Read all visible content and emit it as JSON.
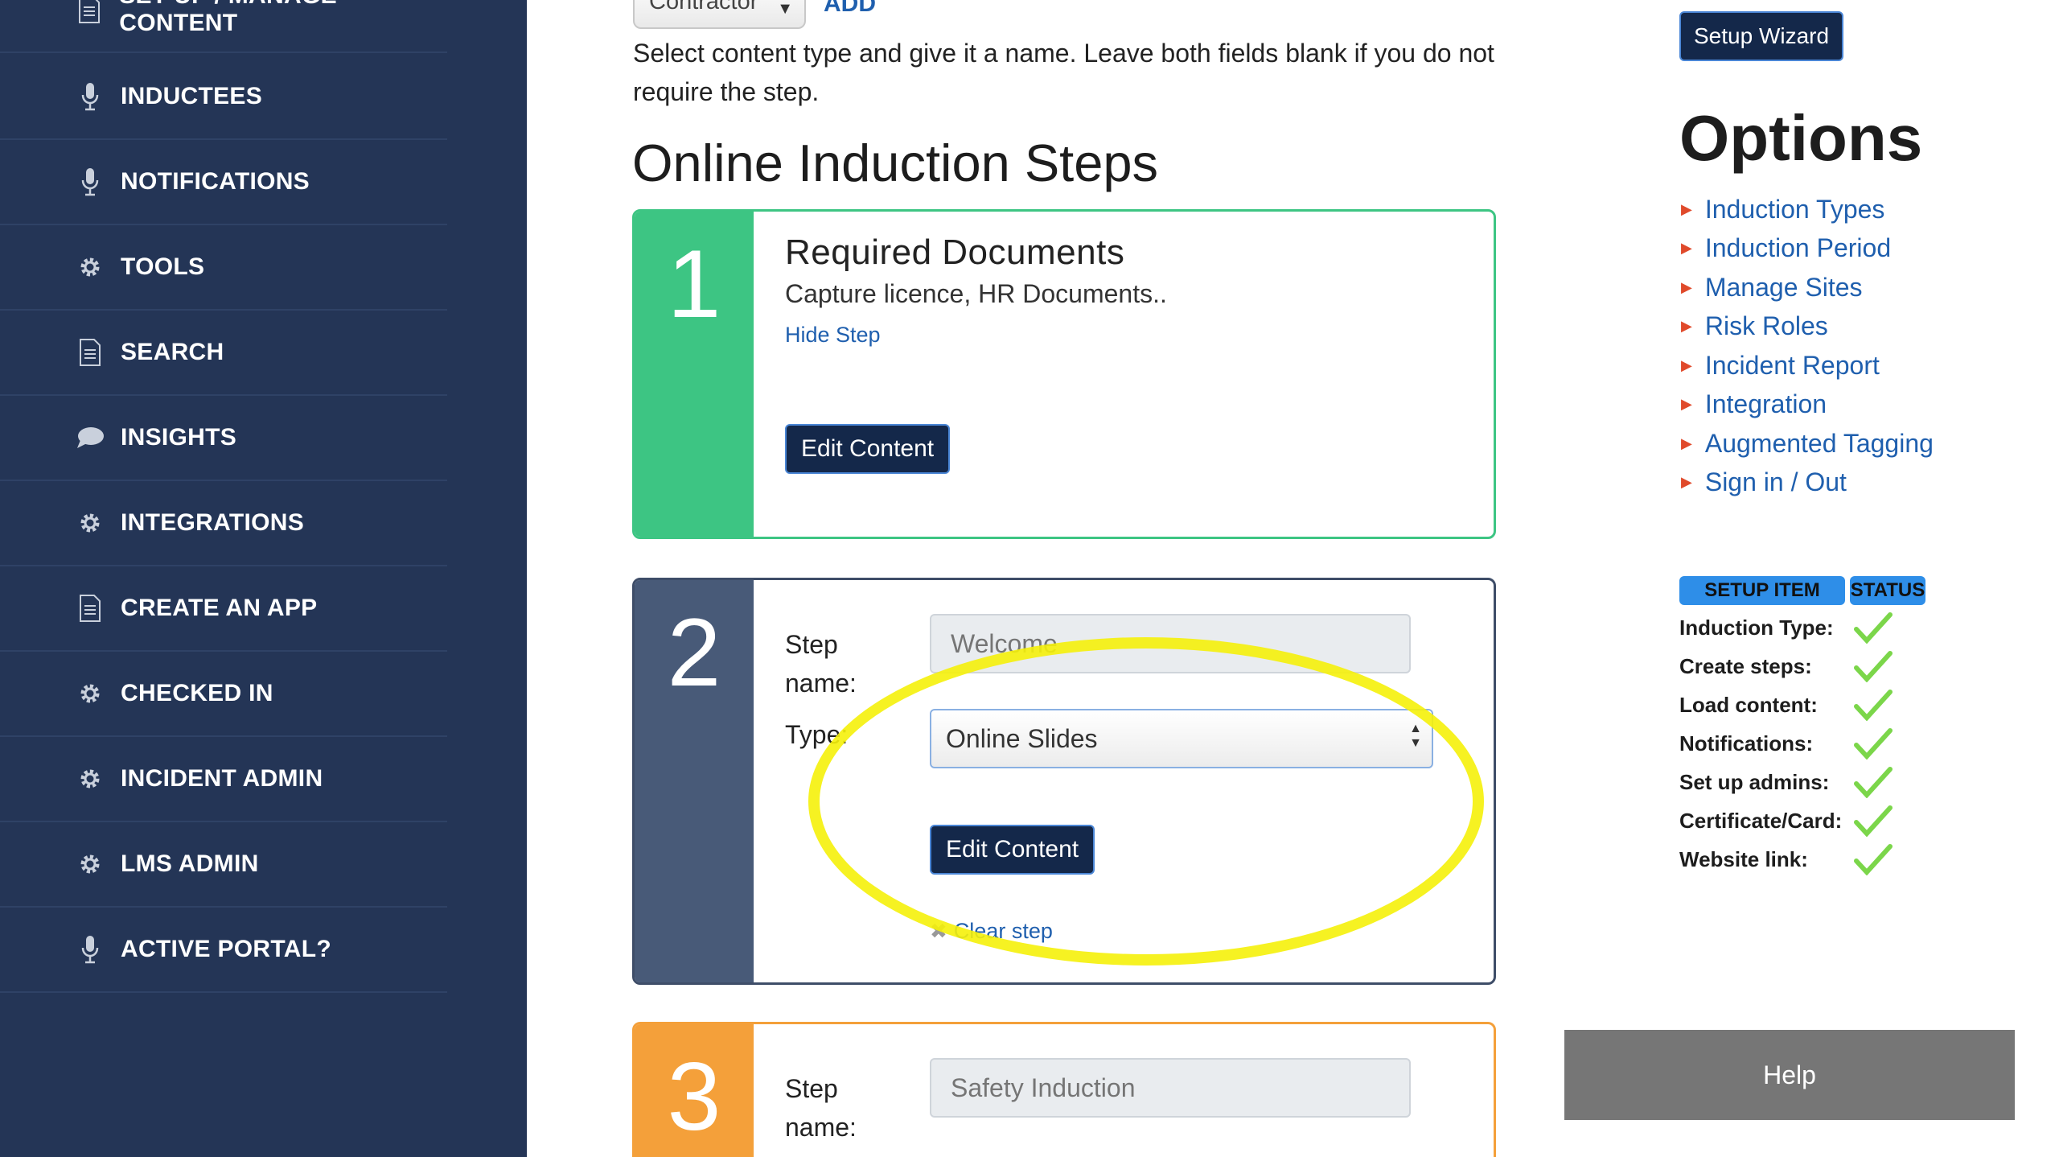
{
  "sidebar": {
    "items": [
      {
        "label": "SET UP / MANAGE CONTENT",
        "icon": "document-icon"
      },
      {
        "label": "INDUCTEES",
        "icon": "microphone-icon"
      },
      {
        "label": "NOTIFICATIONS",
        "icon": "microphone-icon"
      },
      {
        "label": "TOOLS",
        "icon": "gear-icon"
      },
      {
        "label": "SEARCH",
        "icon": "document-icon"
      },
      {
        "label": "INSIGHTS",
        "icon": "chat-bubble-icon"
      },
      {
        "label": "INTEGRATIONS",
        "icon": "gear-icon"
      },
      {
        "label": "CREATE AN APP",
        "icon": "document-icon"
      },
      {
        "label": "CHECKED IN",
        "icon": "gear-icon"
      },
      {
        "label": "INCIDENT ADMIN",
        "icon": "gear-icon"
      },
      {
        "label": "LMS ADMIN",
        "icon": "gear-icon"
      },
      {
        "label": "ACTIVE PORTAL?",
        "icon": "microphone-icon"
      }
    ]
  },
  "main": {
    "top_select_value": "Contractor",
    "top_link": "ADD",
    "intro_text": "Select content type and give it a name. Leave both fields blank if you do not require the step.",
    "section_title": "Online Induction Steps",
    "step1": {
      "number": "1",
      "title": "Required Documents",
      "description": "Capture licence, HR Documents..",
      "hide_link": "Hide Step",
      "edit_button": "Edit Content"
    },
    "step2": {
      "number": "2",
      "step_name_label": "Step name:",
      "step_name_value": "Welcome",
      "type_label": "Type:",
      "type_value": "Online Slides",
      "edit_button": "Edit Content",
      "clear_link": "Clear step"
    },
    "step3": {
      "number": "3",
      "step_name_label": "Step name:",
      "step_name_value": "Safety Induction"
    }
  },
  "right": {
    "wizard_button": "Setup Wizard",
    "options_title": "Options",
    "options": [
      "Induction Types",
      "Induction Period",
      "Manage Sites",
      "Risk Roles",
      "Incident Report",
      "Integration",
      "Augmented Tagging",
      "Sign in / Out"
    ],
    "setup_header": {
      "item": "SETUP ITEM",
      "status": "STATUS"
    },
    "setup_items": [
      {
        "label": "Induction Type:",
        "status": "complete"
      },
      {
        "label": "Create steps:",
        "status": "complete"
      },
      {
        "label": "Load content:",
        "status": "complete"
      },
      {
        "label": "Notifications:",
        "status": "complete"
      },
      {
        "label": "Set up admins:",
        "status": "complete"
      },
      {
        "label": "Certificate/Card:",
        "status": "complete"
      },
      {
        "label": "Website link:",
        "status": "complete"
      }
    ],
    "help_button": "Help"
  },
  "colors": {
    "sidebar_bg": "#243556",
    "step1_accent": "#3dc583",
    "step2_accent": "#485a78",
    "step3_accent": "#f4a03a",
    "link": "#1f5fae",
    "check": "#7bd64a",
    "highlight": "#f5f10a"
  }
}
